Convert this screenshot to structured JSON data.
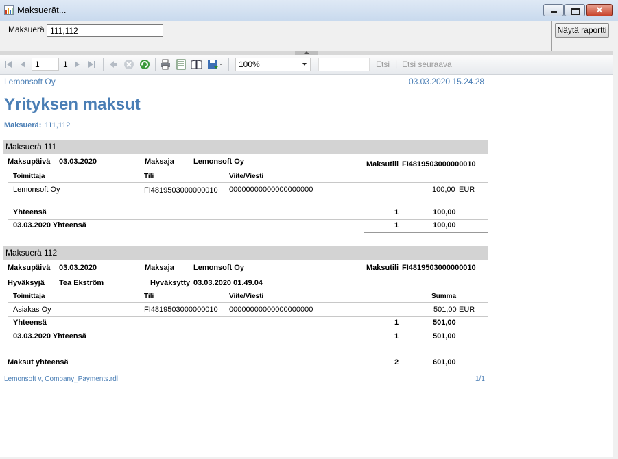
{
  "window": {
    "title": "Maksuerät..."
  },
  "params": {
    "label": "Maksuerä",
    "value": "111,112",
    "view_button": "Näytä raportti"
  },
  "toolbar": {
    "page_current": "1",
    "page_total": "1",
    "zoom": "100%",
    "find_label": "Etsi",
    "find_sep": "|",
    "find_next_label": "Etsi seuraava"
  },
  "report": {
    "company": "Lemonsoft Oy",
    "timestamp": "03.03.2020 15.24.28",
    "title": "Yrityksen maksut",
    "filter_label": "Maksuerä:",
    "filter_value": "111,112",
    "batches": [
      {
        "header": "Maksuerä 111",
        "pay_date_label": "Maksupäivä",
        "pay_date": "03.03.2020",
        "payer_label": "Maksaja",
        "payer": "Lemonsoft Oy",
        "account_label": "Maksutili",
        "account": "FI4819503000000010",
        "col_supplier": "Toimittaja",
        "col_account": "Tili",
        "col_ref": "Viite/Viesti",
        "col_sum": "",
        "rows": [
          {
            "supplier": "Lemonsoft Oy",
            "account": "FI4819503000000010",
            "ref": "00000000000000000000",
            "amount": "100,00",
            "currency": "EUR"
          }
        ],
        "total_label": "Yhteensä",
        "total_count": "1",
        "total_amount": "100,00",
        "date_total_label": "03.03.2020 Yhteensä",
        "date_total_count": "1",
        "date_total_amount": "100,00"
      },
      {
        "header": "Maksuerä 112",
        "pay_date_label": "Maksupäivä",
        "pay_date": "03.03.2020",
        "payer_label": "Maksaja",
        "payer": "Lemonsoft Oy",
        "account_label": "Maksutili",
        "account": "FI4819503000000010",
        "approver_label": "Hyväksyjä",
        "approver": "Tea Ekström",
        "approved_label": "Hyväksytty",
        "approved": "03.03.2020 01.49.04",
        "col_supplier": "Toimittaja",
        "col_account": "Tili",
        "col_ref": "Viite/Viesti",
        "col_sum": "Summa",
        "rows": [
          {
            "supplier": "Asiakas Oy",
            "account": "FI4819503000000010",
            "ref": "00000000000000000000",
            "amount": "501,00",
            "currency": "EUR"
          }
        ],
        "total_label": "Yhteensä",
        "total_count": "1",
        "total_amount": "501,00",
        "date_total_label": "03.03.2020 Yhteensä",
        "date_total_count": "1",
        "date_total_amount": "501,00"
      }
    ],
    "grand_total_label": "Maksut yhteensä",
    "grand_total_count": "2",
    "grand_total_amount": "601,00",
    "footer_left": "Lemonsoft v, Company_Payments.rdl",
    "footer_right": "1/1"
  },
  "colors": {
    "accent": "#4a7eb5",
    "band": "#d3d3d3"
  }
}
